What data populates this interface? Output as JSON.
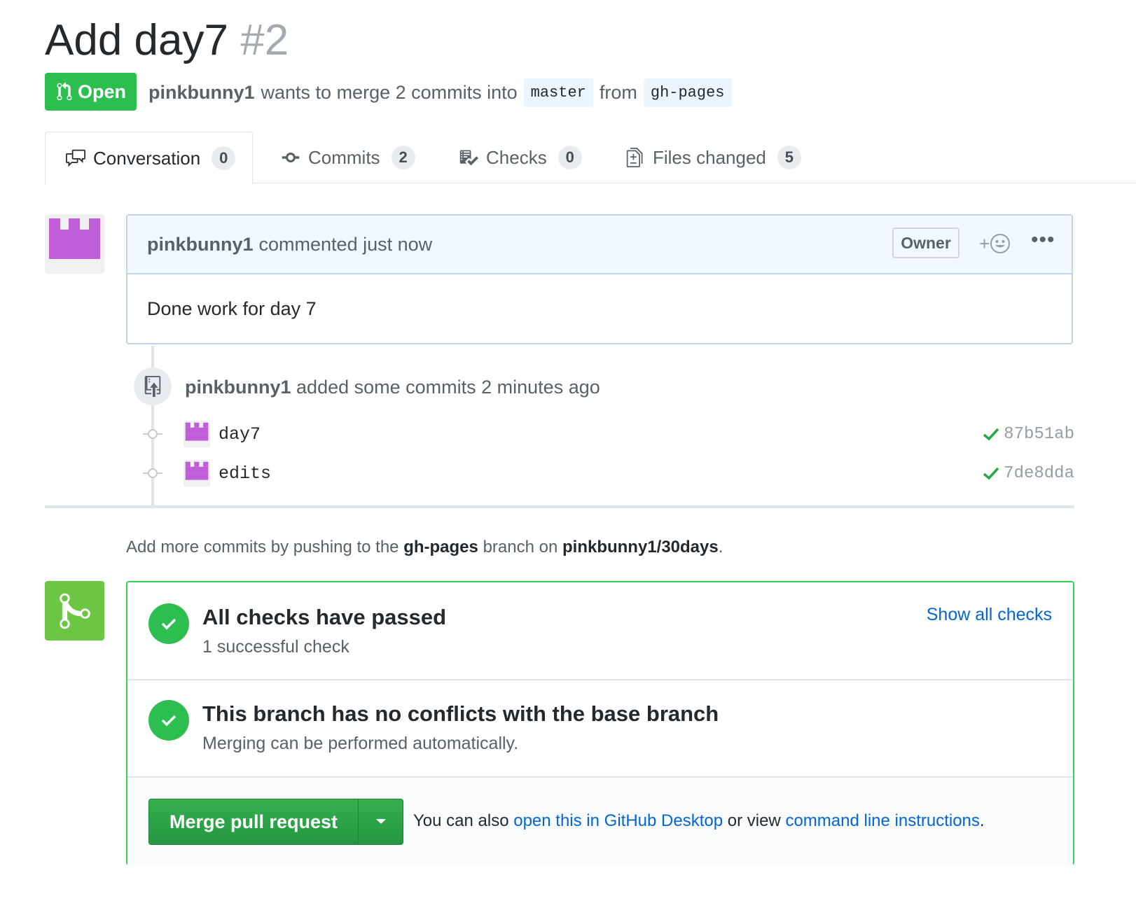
{
  "pr": {
    "title": "Add day7",
    "number": "#2",
    "state": "Open",
    "author": "pinkbunny1",
    "summary": "wants to merge 2 commits into",
    "base_branch": "master",
    "from": "from",
    "head_branch": "gh-pages"
  },
  "tabs": [
    {
      "label": "Conversation",
      "count": "0"
    },
    {
      "label": "Commits",
      "count": "2"
    },
    {
      "label": "Checks",
      "count": "0"
    },
    {
      "label": "Files changed",
      "count": "5"
    }
  ],
  "comment": {
    "author": "pinkbunny1",
    "action": "commented just now",
    "badge": "Owner",
    "reaction": "+",
    "more": "•••",
    "body": "Done work for day 7"
  },
  "push_event": {
    "author": "pinkbunny1",
    "text": "added some commits 2 minutes ago"
  },
  "commits": [
    {
      "message": "day7",
      "sha": "87b51ab"
    },
    {
      "message": "edits",
      "sha": "7de8dda"
    }
  ],
  "hint": {
    "prefix": "Add more commits by pushing to the",
    "branch": "gh-pages",
    "middle": "branch on",
    "repo": "pinkbunny1/30days",
    "suffix": "."
  },
  "merge": {
    "checks_title": "All checks have passed",
    "checks_sub": "1 successful check",
    "show_all": "Show all checks",
    "conflicts_title": "This branch has no conflicts with the base branch",
    "conflicts_sub": "Merging can be performed automatically.",
    "button": "Merge pull request",
    "also_prefix": "You can also",
    "desktop_link": "open this in GitHub Desktop",
    "or_view": "or view",
    "cli_link": "command line instructions",
    "also_suffix": "."
  },
  "colors": {
    "open_green": "#2cbe4e",
    "link_blue": "#0366d6",
    "avatar_purple": "#c05dd8"
  }
}
